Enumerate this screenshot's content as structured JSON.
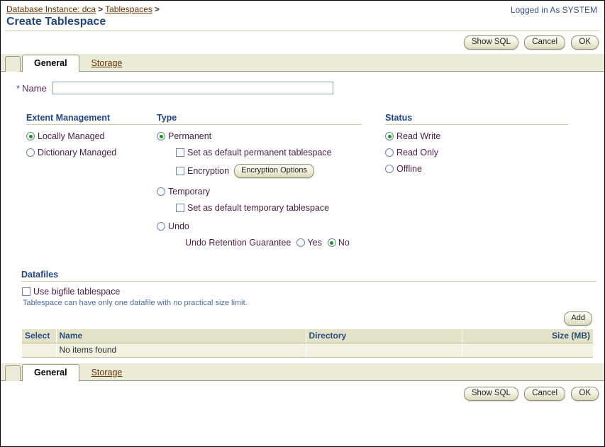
{
  "header": {
    "breadcrumb": [
      {
        "label": "Database Instance: dca",
        "link": true
      },
      {
        "label": ">",
        "link": false
      },
      {
        "label": "Tablespaces",
        "link": true
      },
      {
        "label": ">",
        "link": false
      }
    ],
    "page_title": "Create Tablespace",
    "login_info": "Logged in As SYSTEM"
  },
  "actions": {
    "show_sql": "Show SQL",
    "cancel": "Cancel",
    "ok": "OK"
  },
  "tabs": [
    {
      "label": "General",
      "active": true
    },
    {
      "label": "Storage",
      "active": false
    }
  ],
  "name_field": {
    "required_marker": "*",
    "label": "Name",
    "value": "",
    "placeholder": ""
  },
  "extent_management": {
    "title": "Extent Management",
    "options": [
      {
        "label": "Locally Managed",
        "selected": true
      },
      {
        "label": "Dictionary Managed",
        "selected": false
      }
    ]
  },
  "type": {
    "title": "Type",
    "permanent": {
      "label": "Permanent",
      "selected": true
    },
    "default_permanent": {
      "label": "Set as default permanent tablespace",
      "checked": false
    },
    "encryption": {
      "label": "Encryption",
      "checked": false,
      "button": "Encryption Options"
    },
    "temporary": {
      "label": "Temporary",
      "selected": false
    },
    "default_temporary": {
      "label": "Set as default temporary tablespace",
      "checked": false
    },
    "undo": {
      "label": "Undo",
      "selected": false
    },
    "undo_retention": {
      "label": "Undo Retention Guarantee",
      "yes": {
        "label": "Yes",
        "selected": false
      },
      "no": {
        "label": "No",
        "selected": true
      }
    }
  },
  "status": {
    "title": "Status",
    "options": [
      {
        "label": "Read Write",
        "selected": true
      },
      {
        "label": "Read Only",
        "selected": false
      },
      {
        "label": "Offline",
        "selected": false
      }
    ]
  },
  "datafiles": {
    "title": "Datafiles",
    "bigfile": {
      "label": "Use bigfile tablespace",
      "checked": false
    },
    "hint": "Tablespace can have only one datafile with no practical size limit.",
    "add_button": "Add",
    "columns": [
      "Select",
      "Name",
      "Directory",
      "Size (MB)"
    ],
    "empty_message": "No items found",
    "rows": []
  },
  "colors": {
    "title_blue": "#24467f",
    "link_brown": "#663300",
    "tab_bar": "#ebebd9",
    "rule": "#cfcfae",
    "table_header": "#e3e3c8",
    "table_row": "#f2f2e2",
    "radio_dot_green": "#119911"
  }
}
